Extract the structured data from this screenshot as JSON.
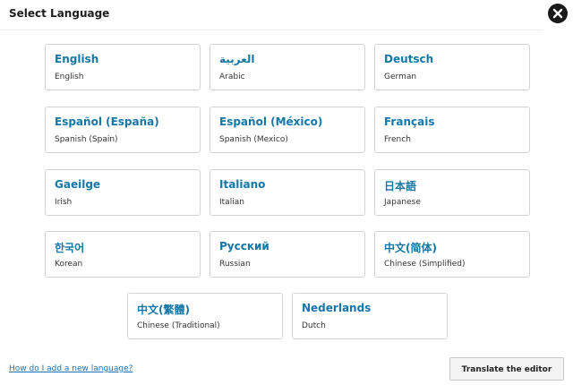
{
  "dialog": {
    "title": "Select Language",
    "close_icon": "close-icon"
  },
  "languages": [
    {
      "native": "English",
      "english": "English"
    },
    {
      "native": "العربية",
      "english": "Arabic"
    },
    {
      "native": "Deutsch",
      "english": "German"
    },
    {
      "native": "Español (España)",
      "english": "Spanish (Spain)"
    },
    {
      "native": "Español (México)",
      "english": "Spanish (Mexico)"
    },
    {
      "native": "Français",
      "english": "French"
    },
    {
      "native": "Gaeilge",
      "english": "Irish"
    },
    {
      "native": "Italiano",
      "english": "Italian"
    },
    {
      "native": "日本語",
      "english": "Japanese"
    },
    {
      "native": "한국어",
      "english": "Korean"
    },
    {
      "native": "Русский",
      "english": "Russian"
    },
    {
      "native": "中文(简体)",
      "english": "Chinese (Simplified)"
    },
    {
      "native": "中文(繁體)",
      "english": "Chinese (Traditional)"
    },
    {
      "native": "Nederlands",
      "english": "Dutch"
    }
  ],
  "footer": {
    "help_link": "How do I add a new language?",
    "translate_button": "Translate the editor"
  },
  "colors": {
    "accent": "#1577a6",
    "link": "#1f6fb2",
    "close_bg": "#1a1a1a"
  }
}
